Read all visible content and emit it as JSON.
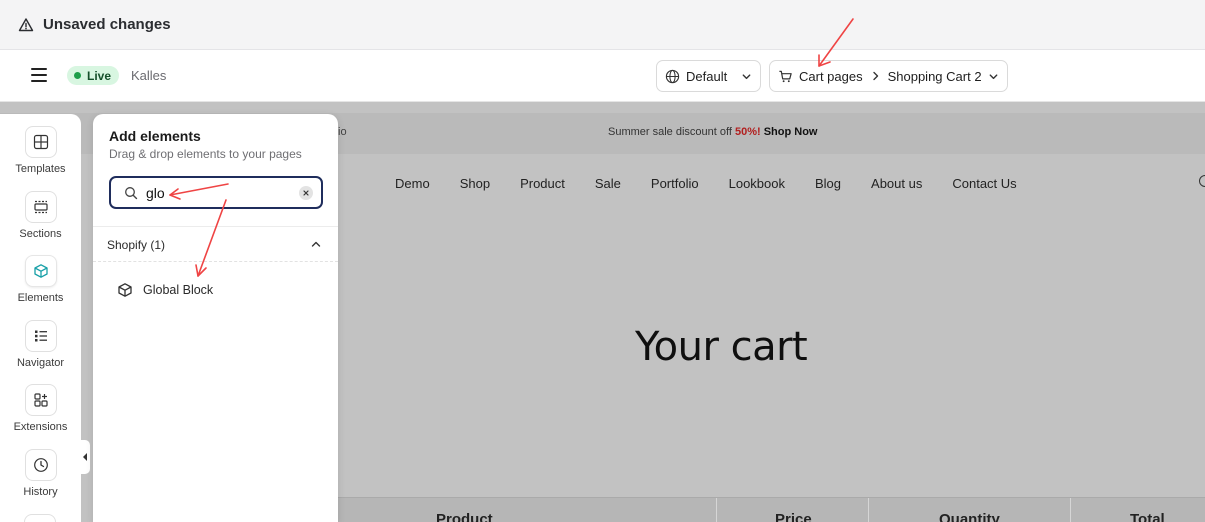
{
  "unsaved_bar": {
    "text": "Unsaved changes",
    "icon": "warning-icon"
  },
  "header": {
    "live_label": "Live",
    "store_name": "Kalles",
    "language_select": {
      "value": "Default",
      "icon": "globe-icon"
    },
    "page_breadcrumb": {
      "type": "Cart pages",
      "page": "Shopping Cart 2",
      "icon": "cart-icon"
    }
  },
  "rail": {
    "items": [
      {
        "label": "Templates",
        "icon": "templates-icon"
      },
      {
        "label": "Sections",
        "icon": "sections-icon"
      },
      {
        "label": "Elements",
        "icon": "cube-icon",
        "active": true
      },
      {
        "label": "Navigator",
        "icon": "list-icon"
      },
      {
        "label": "Extensions",
        "icon": "extensions-icon"
      },
      {
        "label": "History",
        "icon": "clock-icon"
      }
    ]
  },
  "panel": {
    "title": "Add elements",
    "subtitle": "Drag & drop elements to your pages",
    "search_value": "glo",
    "section_label": "Shopify (1)",
    "results": [
      {
        "label": "Global Block",
        "icon": "cube-icon"
      }
    ]
  },
  "preview": {
    "announcement_left_fragment": "io",
    "announcement_text": "Summer sale discount off ",
    "announcement_percent": "50%!",
    "announcement_link": " Shop Now",
    "nav_items": [
      "Demo",
      "Shop",
      "Product",
      "Sale",
      "Portfolio",
      "Lookbook",
      "Blog",
      "About us",
      "Contact Us"
    ],
    "page_title": "Your cart",
    "table_headers": [
      "Product",
      "Price",
      "Quantity",
      "Total"
    ]
  },
  "colors": {
    "accent_focus": "#1f2d5c",
    "live_green": "#1e9e4a",
    "sale_red": "#b22020",
    "annotation_arrow": "#ef4444"
  }
}
